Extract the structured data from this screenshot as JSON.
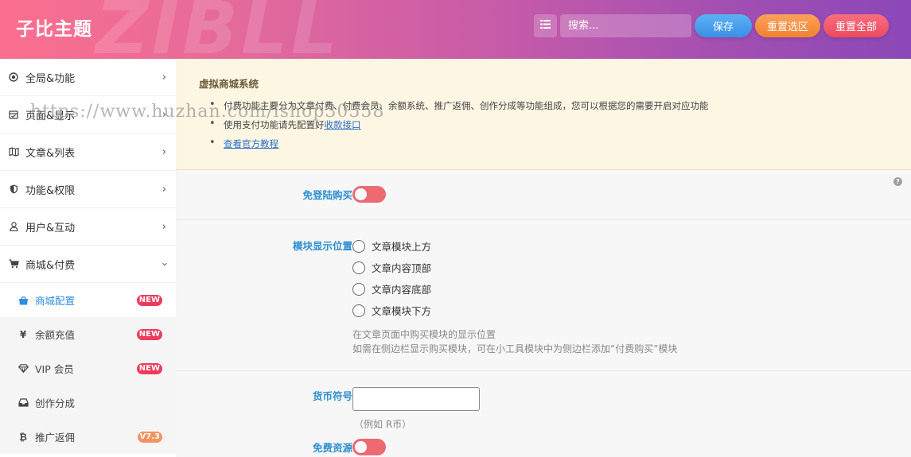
{
  "header": {
    "logo": "子比主题",
    "watermark": "ZIBLL",
    "search_placeholder": "搜索...",
    "save_label": "保存",
    "reset_section_label": "重置选区",
    "reset_all_label": "重置全部"
  },
  "sidebar": {
    "items": [
      {
        "label": "全局&功能",
        "icon": "target-icon"
      },
      {
        "label": "页面&显示",
        "icon": "calendar-icon"
      },
      {
        "label": "文章&列表",
        "icon": "map-icon"
      },
      {
        "label": "功能&权限",
        "icon": "shield-icon"
      },
      {
        "label": "用户&互动",
        "icon": "user-icon"
      },
      {
        "label": "商城&付费",
        "icon": "cart-icon"
      }
    ],
    "subitems": [
      {
        "label": "商城配置",
        "badge": "NEW",
        "icon": "shopping-bag-icon"
      },
      {
        "label": "余额充值",
        "badge": "NEW",
        "icon": "yen-icon"
      },
      {
        "label": "VIP 会员",
        "badge": "NEW",
        "icon": "diamond-icon"
      },
      {
        "label": "创作分成",
        "badge": "",
        "icon": "inbox-icon"
      },
      {
        "label": "推广返佣",
        "badge": "V7.3",
        "icon": "bitcoin-icon"
      }
    ]
  },
  "notice": {
    "title": "虚拟商城系统",
    "line1": "付费功能主要分为文章付费、付费会员、余额系统、推广返佣、创作分成等功能组成，您可以根据您的需要开启对应功能",
    "line2_prefix": "使用支付功能请先配置好",
    "line2_link": "收款接口",
    "line3_link": "查看官方教程"
  },
  "url_watermark": "https://www.huzhan.com/ishop30558",
  "settings": {
    "login_free_buy": {
      "label": "免登陆购买",
      "enabled": false
    },
    "module_position": {
      "label": "模块显示位置",
      "options": [
        "文章模块上方",
        "文章内容顶部",
        "文章内容底部",
        "文章模块下方"
      ],
      "desc1": "在文章页面中购买模块的显示位置",
      "desc2": "如需在侧边栏显示购买模块，可在小工具模块中为侧边栏添加“付费购买”模块"
    },
    "currency_symbol": {
      "label": "货币符号",
      "value": "",
      "hint": "（例如 R币）"
    },
    "free_resources": {
      "label": "免费资源",
      "enabled": false
    }
  },
  "colors": {
    "accent": "#2c8fd1",
    "toggle_off": "#ec6a72",
    "badge_new": "#ec3c5b",
    "badge_version": "#f39460"
  }
}
